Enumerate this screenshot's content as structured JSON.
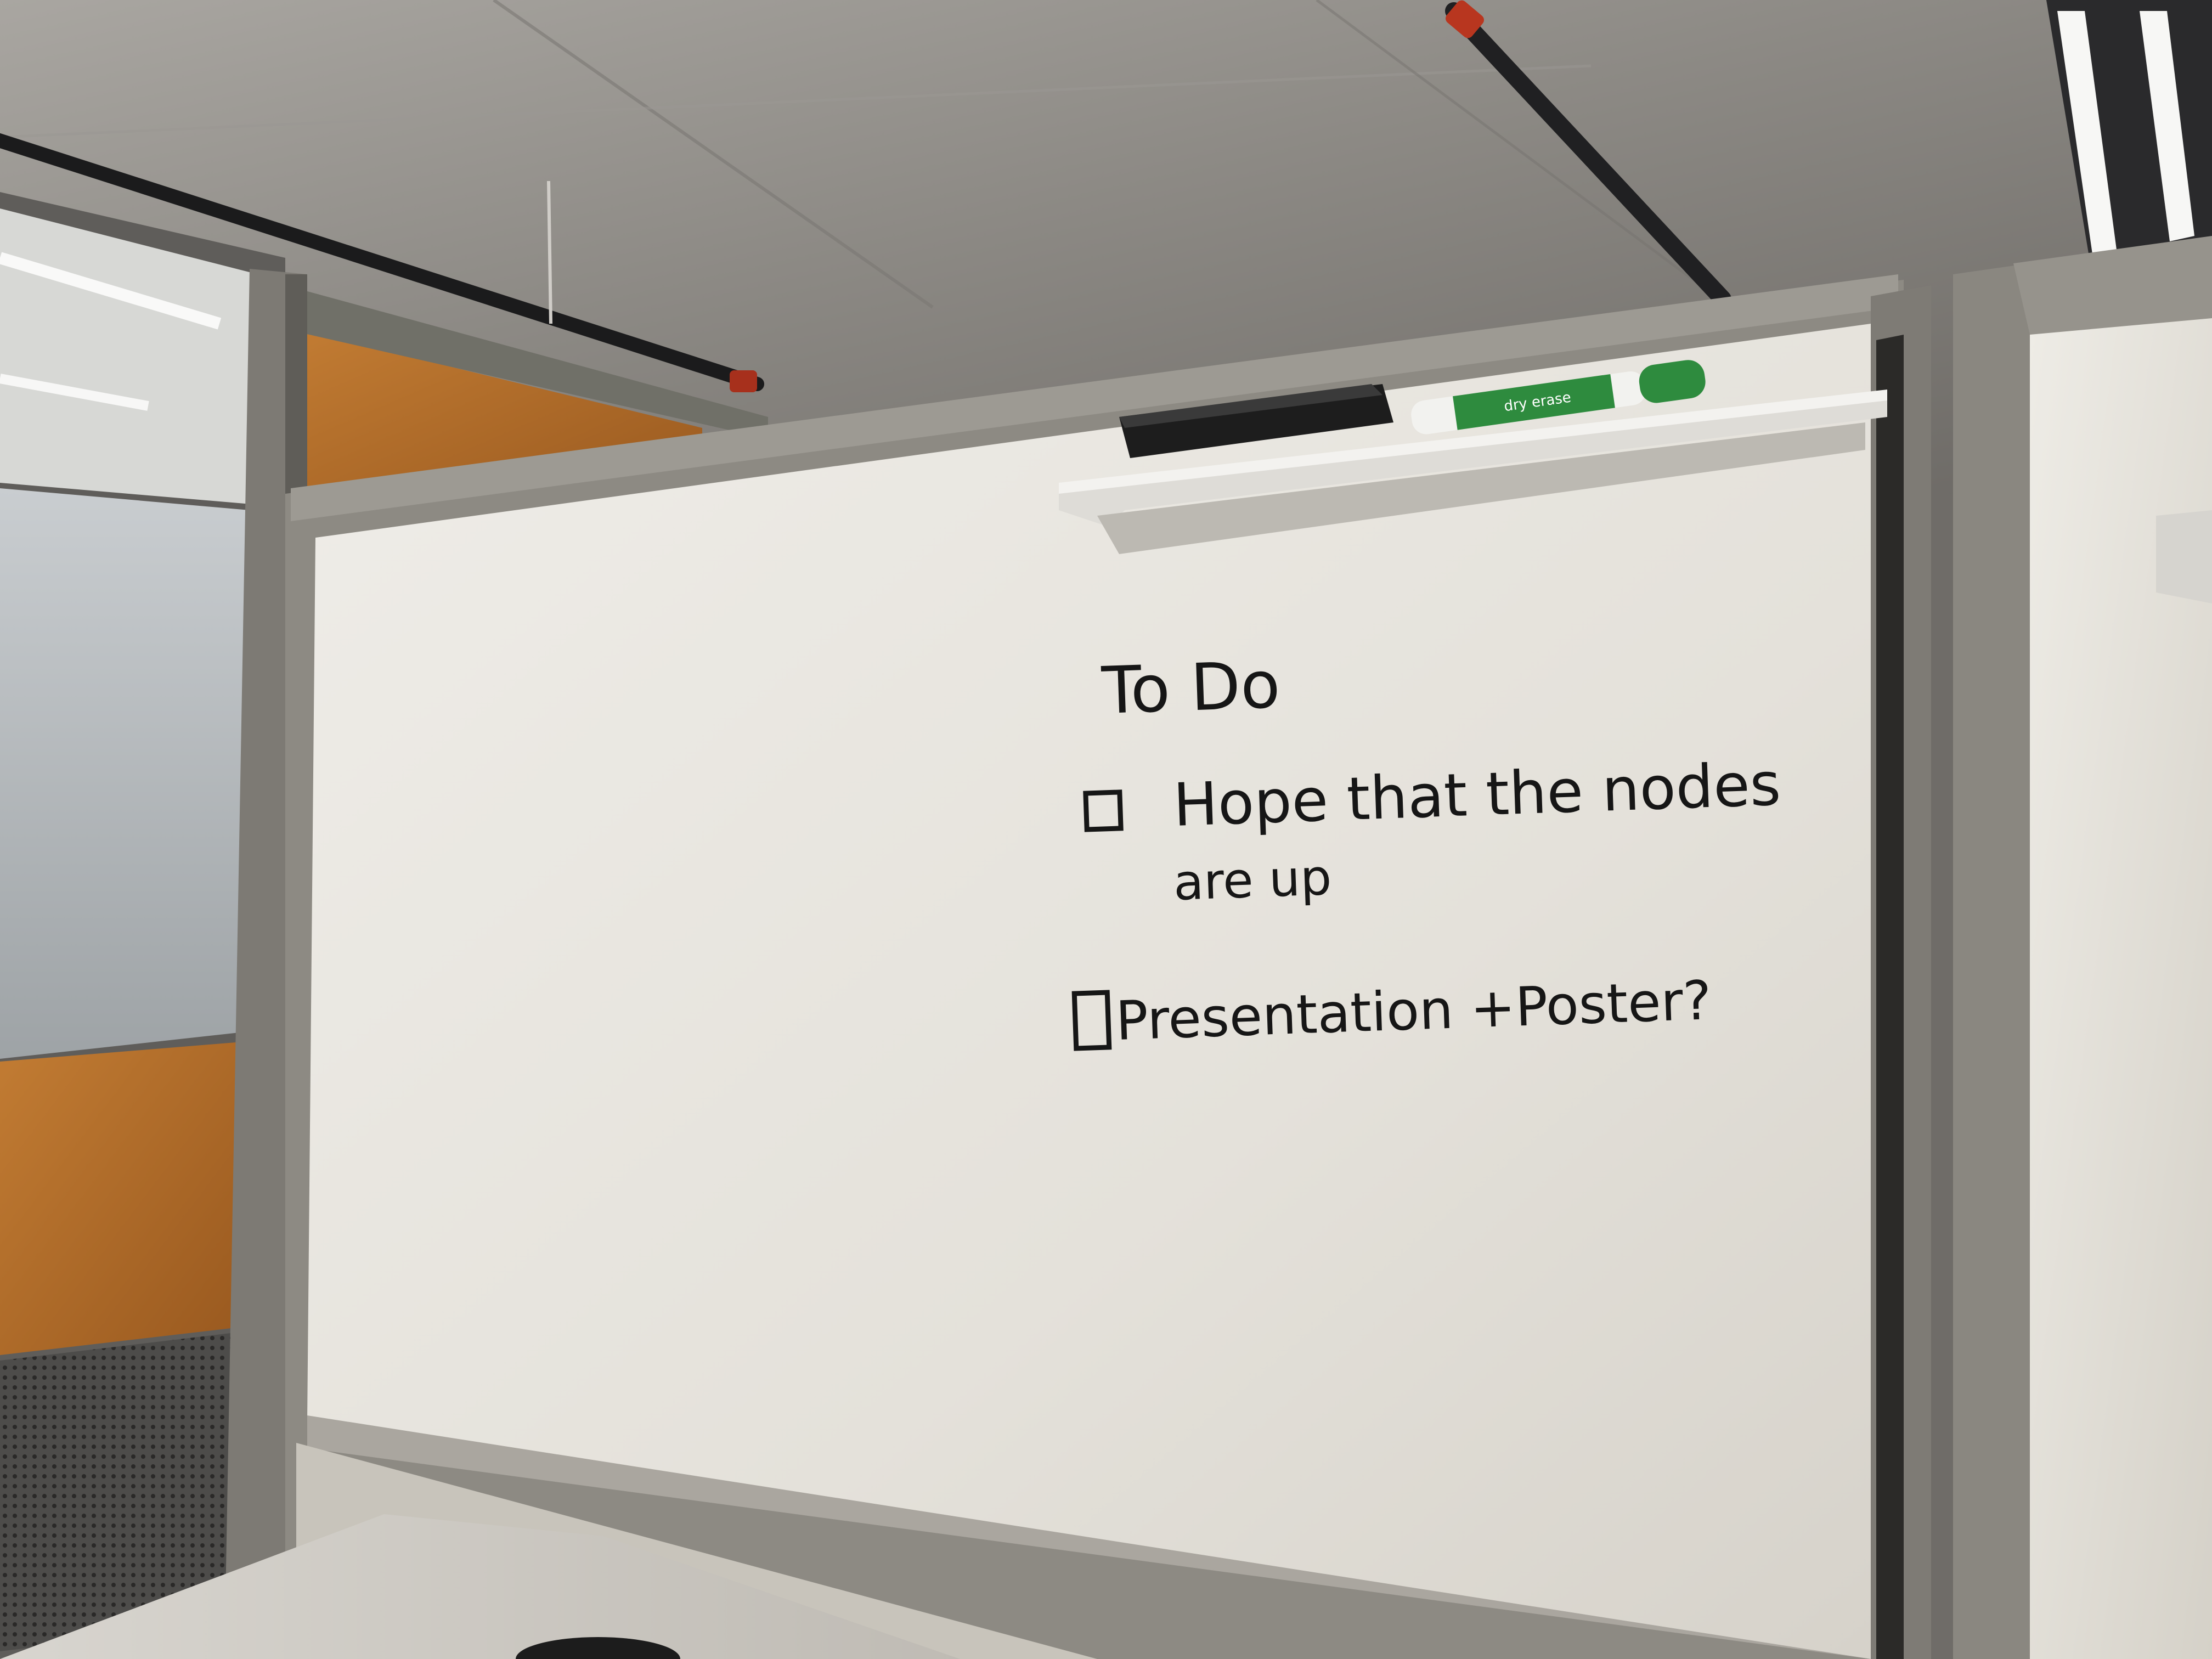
{
  "whiteboard": {
    "heading": "To Do",
    "items": [
      {
        "line1": "Hope that the nodes",
        "line2": "are up",
        "checked": false
      },
      {
        "line1": "Presentation +Poster?",
        "checked": false
      }
    ]
  },
  "tray": {
    "marker_label": "dry erase",
    "marker_color": "#2e8b3e",
    "eraser_color": "#1d1d1d"
  },
  "colors": {
    "ceiling": "#8e8b86",
    "board": "#e9e7e1",
    "frame": "#8d8a83",
    "wood": "#b5702a",
    "ink": "#161616"
  }
}
